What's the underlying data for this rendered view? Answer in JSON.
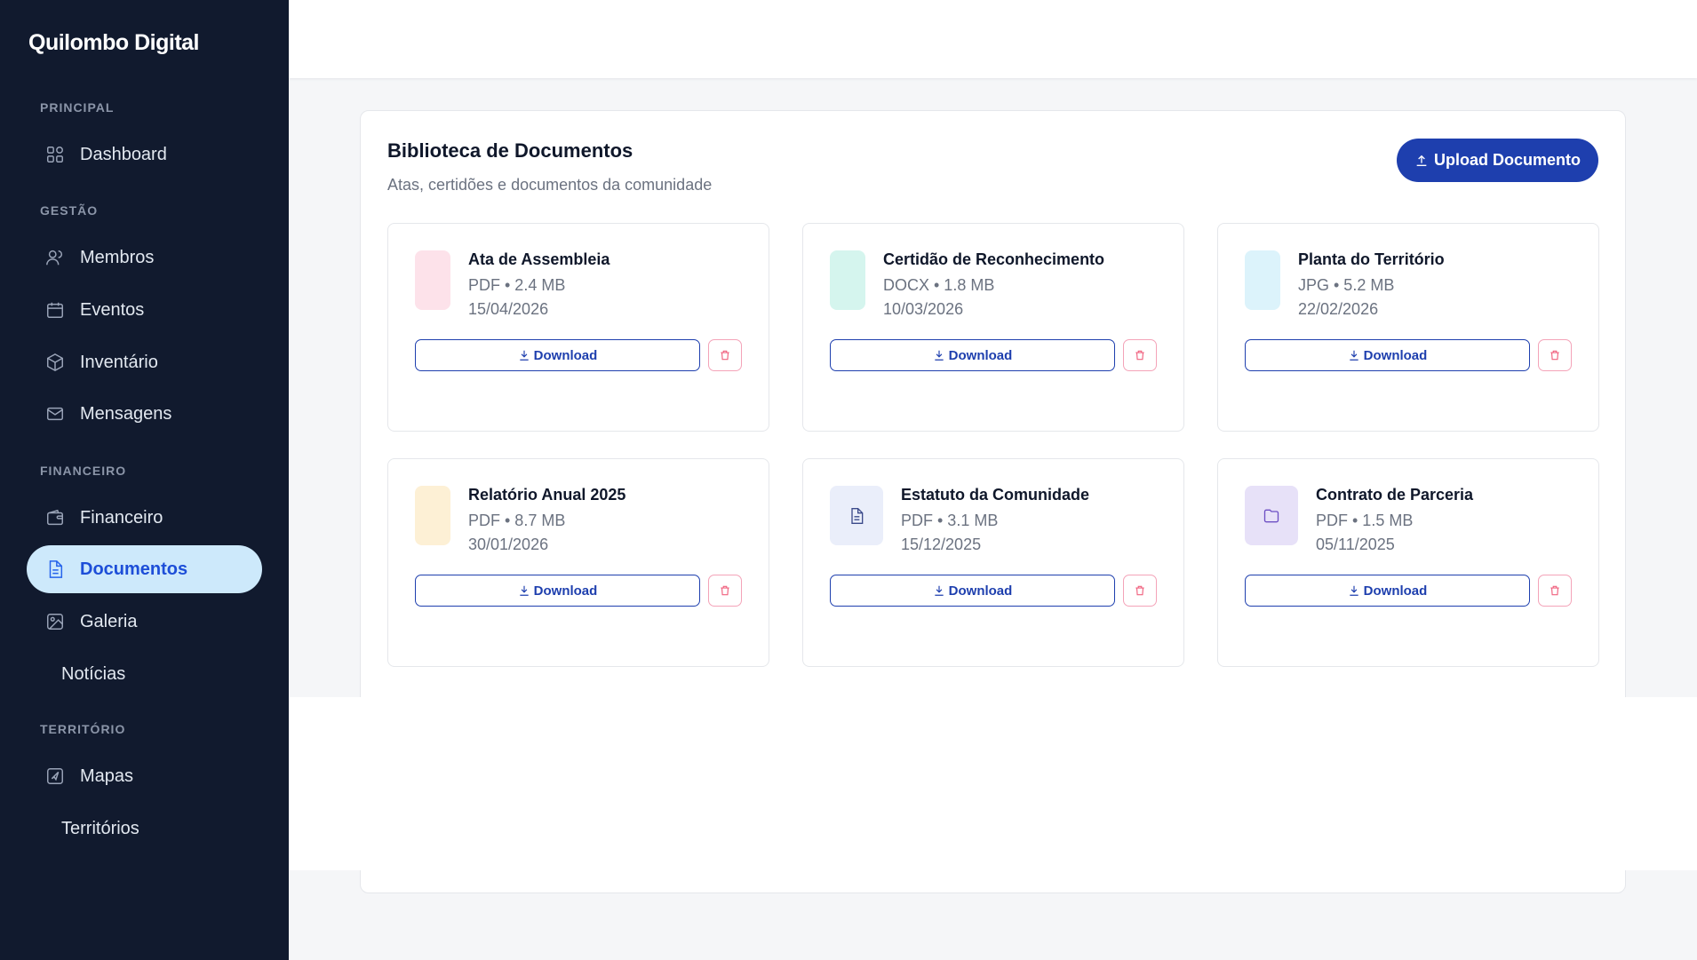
{
  "sidebar": {
    "brand": "Quilombo Digital",
    "sections": {
      "principal": "PRINCIPAL",
      "gestao": "GESTÃO",
      "financeiro": "FINANCEIRO",
      "territorio": "TERRITÓRIO"
    },
    "items": {
      "dashboard": "Dashboard",
      "membros": "Membros",
      "eventos": "Eventos",
      "inventario": "Inventário",
      "mensagens": "Mensagens",
      "financeiro": "Financeiro",
      "documentos": "Documentos",
      "galeria": "Galeria",
      "noticias": "Notícias",
      "mapas": "Mapas",
      "territorios": "Territórios"
    },
    "active_item": "Documentos"
  },
  "library": {
    "title": "Biblioteca de Documentos",
    "subtitle": "Atas, certidões e documentos da comunidade",
    "upload_label": "Upload Documento"
  },
  "documents": [
    {
      "name": "Ata de Assembleia",
      "meta": "PDF • 2.4 MB",
      "date": "15/04/2026",
      "download_label": "Download",
      "thumb_color": "#fde2ea"
    },
    {
      "name": "Certidão de Reconhecimento",
      "meta": "DOCX • 1.8 MB",
      "date": "10/03/2026",
      "download_label": "Download",
      "thumb_color": "#d5f5ee"
    },
    {
      "name": "Planta do Território",
      "meta": "JPG • 5.2 MB",
      "date": "22/02/2026",
      "download_label": "Download",
      "thumb_color": "#dcf3fb"
    },
    {
      "name": "Relatório Anual 2025",
      "meta": "PDF • 8.7 MB",
      "date": "30/01/2026",
      "download_label": "Download",
      "thumb_color": "#fdf0d5"
    },
    {
      "name": "Estatuto da Comunidade",
      "meta": "PDF • 3.1 MB",
      "date": "15/12/2025",
      "download_label": "Download",
      "thumb_color": "#eaeefa",
      "icon": "document-icon"
    },
    {
      "name": "Contrato de Parceria",
      "meta": "PDF • 1.5 MB",
      "date": "05/11/2025",
      "download_label": "Download",
      "thumb_color": "#e7e1f8",
      "icon": "folder-icon"
    }
  ],
  "colors": {
    "sidebar_bg": "#111a2e",
    "accent": "#1e3fae",
    "active_bg": "#cde9fb",
    "danger_border": "#f4a3b8"
  }
}
